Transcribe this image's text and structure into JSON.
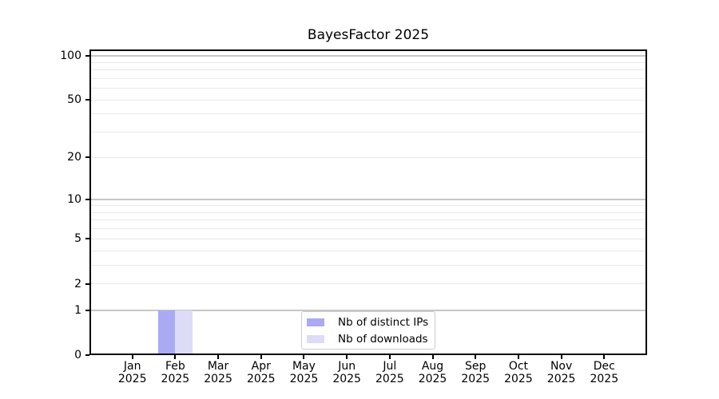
{
  "chart_data": {
    "type": "bar",
    "title": "BayesFactor 2025",
    "categories": [
      "Jan 2025",
      "Feb 2025",
      "Mar 2025",
      "Apr 2025",
      "May 2025",
      "Jun 2025",
      "Jul 2025",
      "Aug 2025",
      "Sep 2025",
      "Oct 2025",
      "Nov 2025",
      "Dec 2025"
    ],
    "series": [
      {
        "name": "Nb of distinct IPs",
        "color": "#aaaaf2",
        "values": [
          0,
          1,
          0,
          0,
          0,
          0,
          0,
          0,
          0,
          0,
          0,
          0
        ]
      },
      {
        "name": "Nb of downloads",
        "color": "#dcdcf7",
        "values": [
          0,
          1,
          0,
          0,
          0,
          0,
          0,
          0,
          0,
          0,
          0,
          0
        ]
      }
    ],
    "xlabel": "",
    "ylabel": "",
    "yscale": "log1p",
    "ylim": [
      0,
      110
    ],
    "yticks": [
      0,
      1,
      2,
      5,
      10,
      20,
      50,
      100
    ],
    "ytick_labels": [
      "0",
      "1",
      "2",
      "5",
      "10",
      "20",
      "50",
      "100"
    ],
    "major_gridline_values": [
      1,
      10,
      100
    ],
    "minor_gridline_values": [
      2,
      3,
      4,
      5,
      6,
      7,
      8,
      9,
      20,
      30,
      40,
      50,
      60,
      70,
      80,
      90
    ],
    "grid": true,
    "legend_position": "lower center"
  },
  "colors": {
    "axis": "#000000",
    "major_grid": "#c6c6c6",
    "minor_grid": "#e9e9e9",
    "background": "#ffffff",
    "distinct_ips_bar": "#aaaaf2",
    "downloads_bar": "#dcdcf7"
  }
}
